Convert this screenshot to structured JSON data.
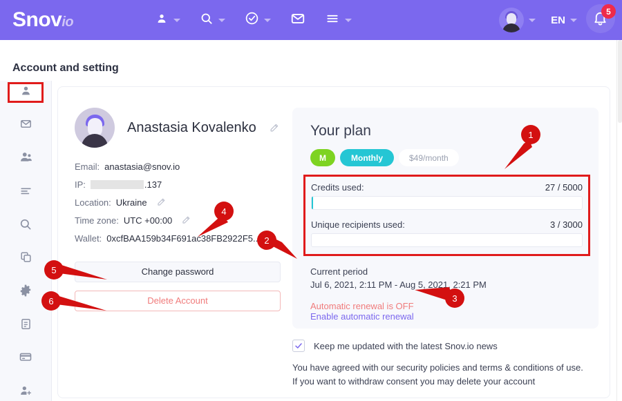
{
  "header": {
    "logo": "Snov",
    "logo_suffix": "io",
    "nav": [
      {
        "icon": "person-icon",
        "name": "prospects-menu"
      },
      {
        "icon": "search-icon",
        "name": "search-menu"
      },
      {
        "icon": "check-circle-icon",
        "name": "verify-menu"
      },
      {
        "icon": "envelope-icon",
        "name": "campaigns-menu"
      },
      {
        "icon": "hamburger-icon",
        "name": "more-menu"
      }
    ],
    "language": "EN",
    "notification_count": "5",
    "avatar_icon": "user-avatar",
    "bell_icon": "bell-icon"
  },
  "page": {
    "title": "Account and setting"
  },
  "sidebar": {
    "items": [
      {
        "icon": "person-icon",
        "name": "sidebar-item-account",
        "active": true
      },
      {
        "icon": "envelope-icon",
        "name": "sidebar-item-email"
      },
      {
        "icon": "team-icon",
        "name": "sidebar-item-team"
      },
      {
        "icon": "list-icon",
        "name": "sidebar-item-lists"
      },
      {
        "icon": "search-icon",
        "name": "sidebar-item-search"
      },
      {
        "icon": "copy-icon",
        "name": "sidebar-item-integrations"
      },
      {
        "icon": "gear-icon",
        "name": "sidebar-item-settings"
      },
      {
        "icon": "document-icon",
        "name": "sidebar-item-documents"
      },
      {
        "icon": "card-icon",
        "name": "sidebar-item-billing"
      },
      {
        "icon": "person-add-icon",
        "name": "sidebar-item-invite"
      }
    ]
  },
  "profile": {
    "name": "Anastasia Kovalenko",
    "email_label": "Email:",
    "email_value": "anastasia@snov.io",
    "ip_label": "IP:",
    "ip_value": ".137",
    "location_label": "Location:",
    "location_value": "Ukraine",
    "timezone_label": "Time zone:",
    "timezone_value": "UTC +00:00",
    "wallet_label": "Wallet:",
    "wallet_value": "0xcfBAA159b34F691ac38FB2922F5...",
    "change_password_label": "Change password",
    "delete_account_label": "Delete Account"
  },
  "plan": {
    "title": "Your plan",
    "badge_letter": "M",
    "badge_period": "Monthly",
    "badge_price": "$49/month",
    "credits_label": "Credits used:",
    "credits_value": "27 / 5000",
    "credits_percent": 0.54,
    "recipients_label": "Unique recipients used:",
    "recipients_value": "3 / 3000",
    "recipients_percent": 0.1,
    "period_title": "Current period",
    "period_value": "Jul 6, 2021, 2:11 PM - Aug 5, 2021, 2:21 PM",
    "renewal_status": "Automatic renewal is OFF",
    "renewal_link": "Enable automatic renewal"
  },
  "consent": {
    "checkbox_label": "Keep me updated with the latest Snov.io news",
    "checked": true,
    "legal_line1": "You have agreed with our security policies and terms & conditions of use.",
    "legal_line2": "If you want to withdraw consent you may delete your account"
  },
  "annotations": [
    {
      "id": "1",
      "label": "1"
    },
    {
      "id": "2",
      "label": "2"
    },
    {
      "id": "3",
      "label": "3"
    },
    {
      "id": "4",
      "label": "4"
    },
    {
      "id": "5",
      "label": "5"
    },
    {
      "id": "6",
      "label": "6"
    }
  ],
  "colors": {
    "brand_purple": "#7b68ee",
    "accent_teal": "#25c6d4",
    "accent_green": "#7ed321",
    "annotation_red": "#d31010",
    "danger": "#f07b7b"
  }
}
